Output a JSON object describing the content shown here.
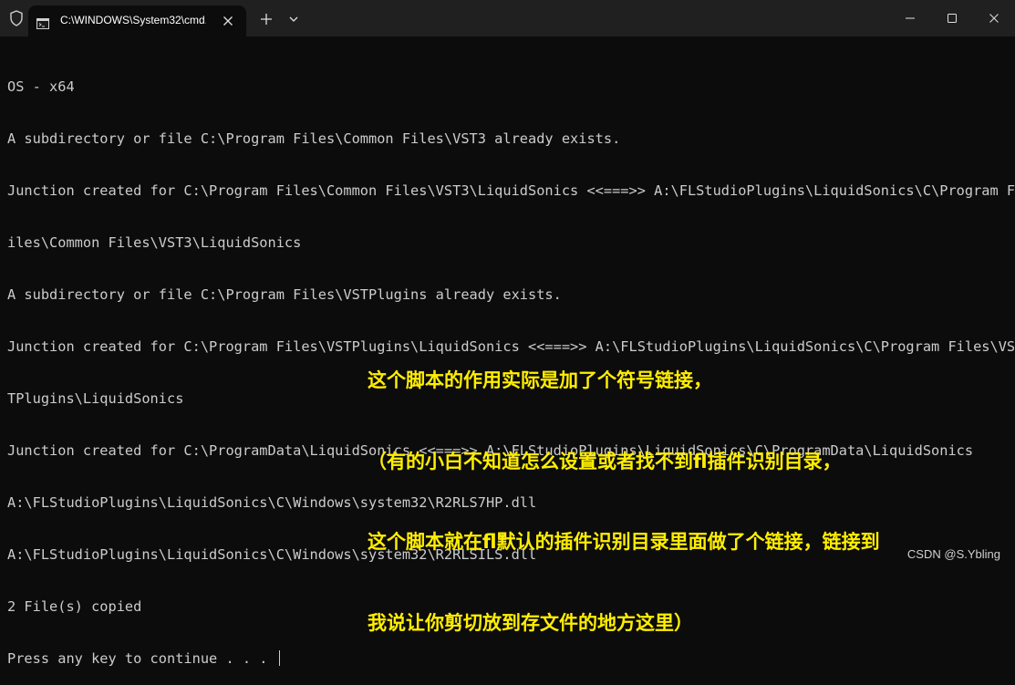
{
  "window": {
    "tab_title": "C:\\WINDOWS\\System32\\cmd.",
    "icons": {
      "shield": "shield-icon",
      "tab_icon": "terminal-icon",
      "tab_close": "close-icon",
      "new_tab": "plus-icon",
      "dropdown": "chevron-down-icon",
      "minimize": "minimize-icon",
      "maximize": "maximize-icon",
      "close": "close-icon"
    }
  },
  "console": {
    "lines": [
      "OS - x64",
      "A subdirectory or file C:\\Program Files\\Common Files\\VST3 already exists.",
      "Junction created for C:\\Program Files\\Common Files\\VST3\\LiquidSonics <<===>> A:\\FLStudioPlugins\\LiquidSonics\\C\\Program F",
      "iles\\Common Files\\VST3\\LiquidSonics",
      "A subdirectory or file C:\\Program Files\\VSTPlugins already exists.",
      "Junction created for C:\\Program Files\\VSTPlugins\\LiquidSonics <<===>> A:\\FLStudioPlugins\\LiquidSonics\\C\\Program Files\\VS",
      "TPlugins\\LiquidSonics",
      "Junction created for C:\\ProgramData\\LiquidSonics <<===>> A:\\FLStudioPlugins\\LiquidSonics\\C\\ProgramData\\LiquidSonics",
      "A:\\FLStudioPlugins\\LiquidSonics\\C\\Windows\\system32\\R2RLS7HP.dll",
      "A:\\FLStudioPlugins\\LiquidSonics\\C\\Windows\\system32\\R2RLSILS.dll",
      "2 File(s) copied",
      "Press any key to continue . . . "
    ]
  },
  "annotation": {
    "lines": [
      "这个脚本的作用实际是加了个符号链接，",
      "（有的小白不知道怎么设置或者找不到fl插件识别目录，",
      "这个脚本就在fl默认的插件识别目录里面做了个链接，链接到",
      "我说让你剪切放到存文件的地方这里）"
    ]
  },
  "watermark": "CSDN @S.Ybling",
  "colors": {
    "background": "#0c0c0c",
    "titlebar": "#202020",
    "console_text": "#cccccc",
    "annotation_text": "#ffee00"
  }
}
